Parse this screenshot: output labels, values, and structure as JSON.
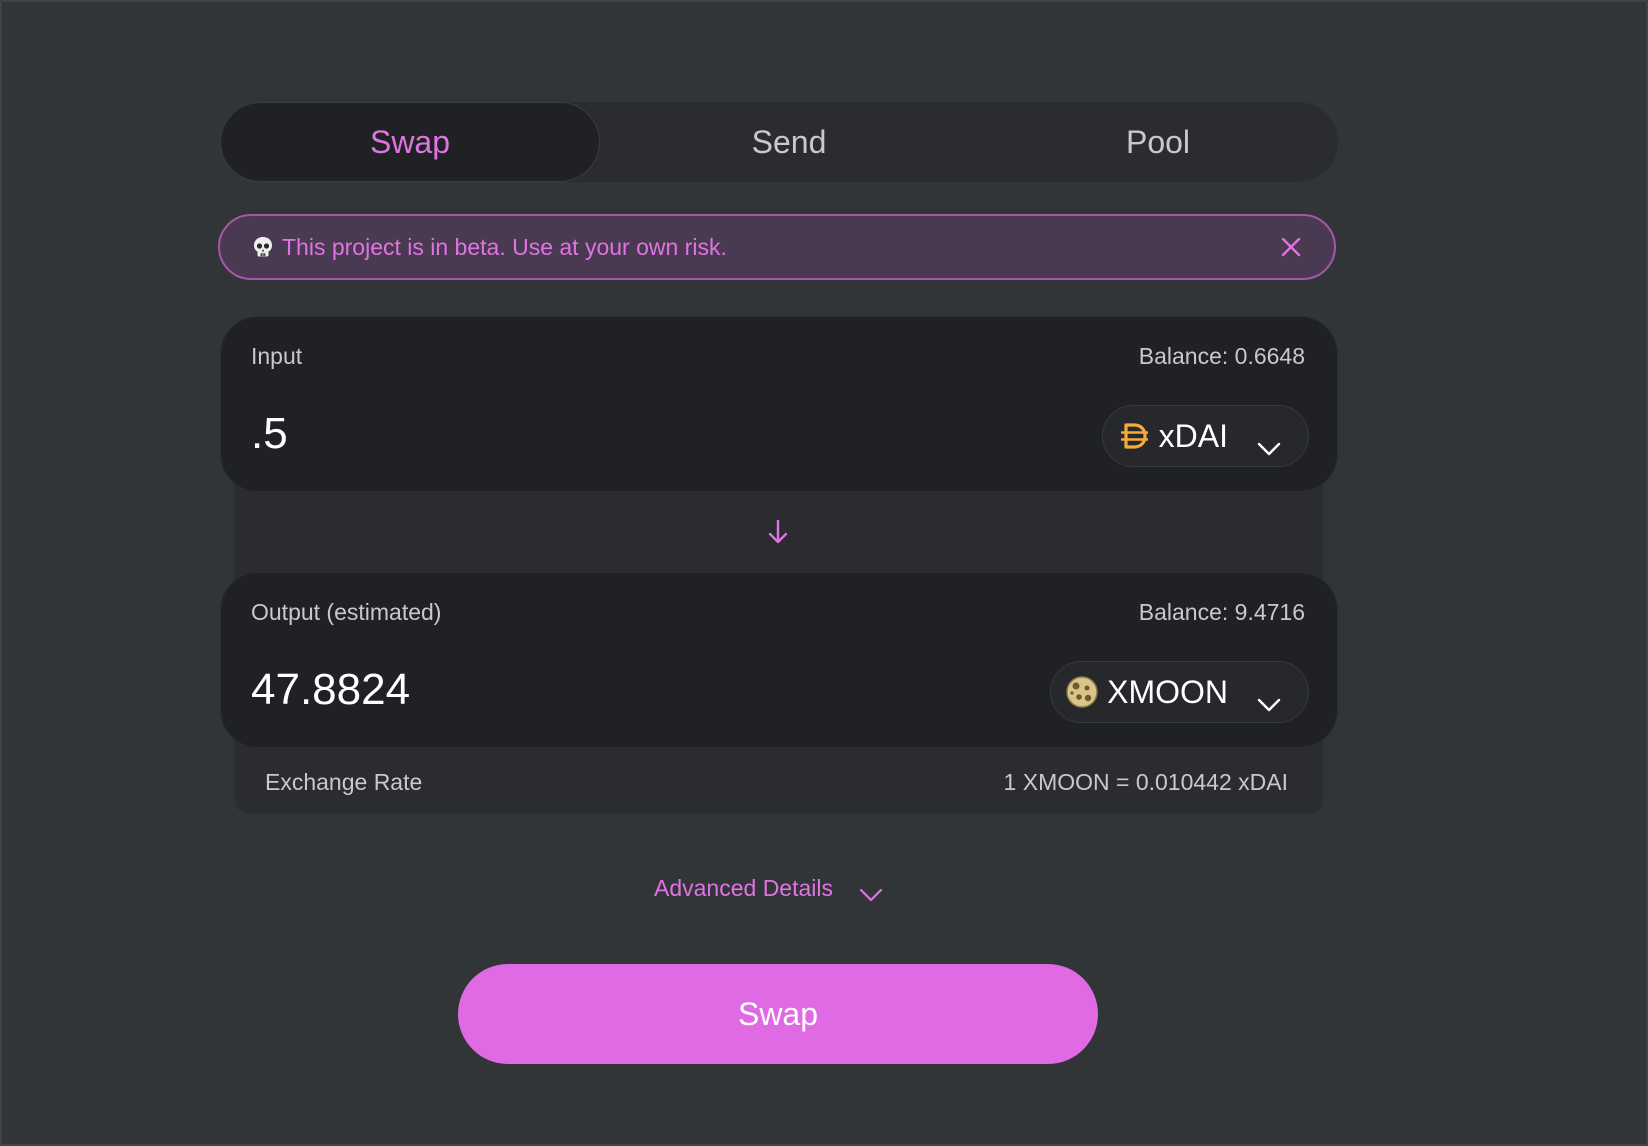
{
  "tabs": [
    {
      "label": "Swap",
      "active": true
    },
    {
      "label": "Send",
      "active": false
    },
    {
      "label": "Pool",
      "active": false
    }
  ],
  "warning": {
    "icon": "skull-icon",
    "text": "This project is in beta. Use at your own risk."
  },
  "input": {
    "label": "Input",
    "balance": "Balance: 0.6648",
    "amount": ".5",
    "token": "xDAI",
    "token_icon": "xdai-icon"
  },
  "output": {
    "label": "Output (estimated)",
    "balance": "Balance: 9.4716",
    "amount": "47.8824",
    "token": "XMOON",
    "token_icon": "xmoon-icon"
  },
  "exchange_rate": {
    "label": "Exchange Rate",
    "value": "1 XMOON = 0.010442 xDAI"
  },
  "advanced_details": {
    "label": "Advanced Details"
  },
  "swap_button": {
    "label": "Swap"
  },
  "colors": {
    "accent": "#df6ae3",
    "background": "#323538",
    "panel": "#202124",
    "xdai": "#f5ac37"
  }
}
